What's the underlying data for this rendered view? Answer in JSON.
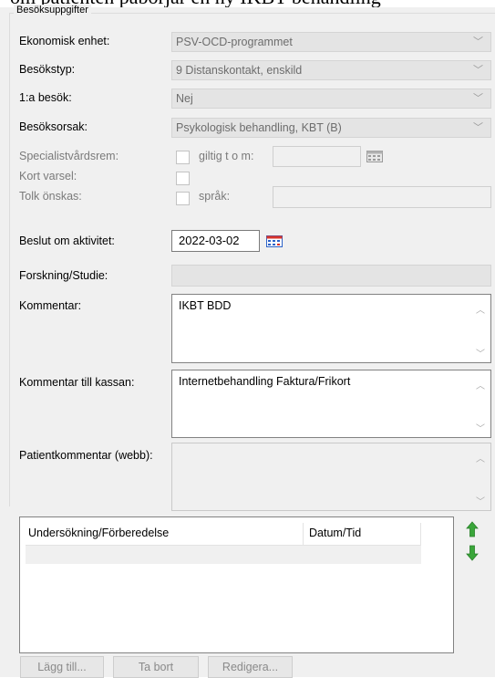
{
  "top_strip": "om patienten påbörjar en ny IKBT-behandling",
  "group": {
    "title": "Besöksuppgifter"
  },
  "fields": {
    "ekonomisk_enhet": {
      "label": "Ekonomisk enhet:",
      "value": "PSV-OCD-programmet"
    },
    "besokstyp": {
      "label": "Besökstyp:",
      "value": "9 Distanskontakt, enskild"
    },
    "forsta_besok": {
      "label": "1:a besök:",
      "value": "Nej"
    },
    "besoksorsak": {
      "label": "Besöksorsak:",
      "value": "Psykologisk behandling, KBT (B)"
    },
    "specialistvardsrem": {
      "label": "Specialistvårdsrem:",
      "checkbox_label": "giltig t o m:",
      "checked": false,
      "date": ""
    },
    "kort_varsel": {
      "label": "Kort varsel:",
      "checked": false
    },
    "tolk": {
      "label": "Tolk önskas:",
      "checkbox_label": "språk:",
      "checked": false,
      "language": ""
    },
    "beslut": {
      "label": "Beslut om aktivitet:",
      "value": "2022-03-02"
    },
    "forskning": {
      "label": "Forskning/Studie:",
      "value": ""
    },
    "kommentar": {
      "label": "Kommentar:",
      "value": "IKBT BDD"
    },
    "kommentar_kassan": {
      "label": "Kommentar till kassan:",
      "value": "Internetbehandling Faktura/Frikort"
    },
    "patientkommentar": {
      "label": "Patientkommentar (webb):",
      "value": ""
    }
  },
  "table": {
    "columns": [
      "Undersökning/Förberedelse",
      "Datum/Tid"
    ],
    "rows": []
  },
  "buttons": {
    "add": "Lägg till...",
    "remove": "Ta bort",
    "edit": "Redigera..."
  },
  "icons": {
    "combo_arrow": "chevron-down-icon",
    "calendar": "calendar-icon",
    "move_up": "arrow-up-icon",
    "move_down": "arrow-down-icon"
  },
  "colors": {
    "arrow_green": "#3aa63a",
    "calendar_red": "#d9342b",
    "calendar_blue": "#2d63c8"
  }
}
